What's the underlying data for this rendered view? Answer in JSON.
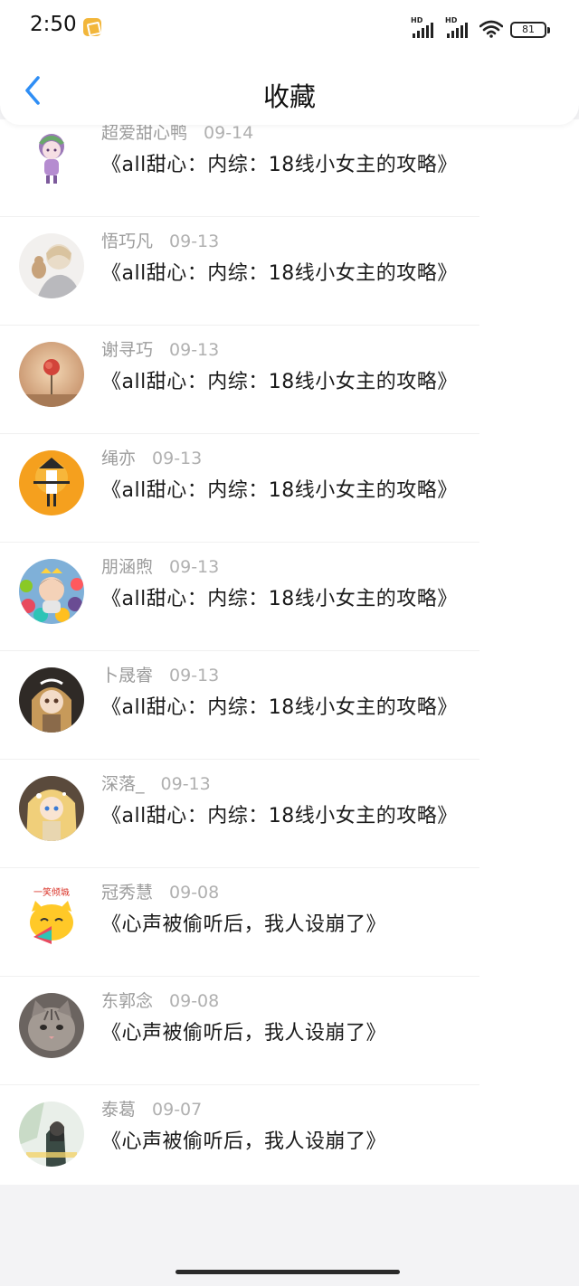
{
  "status_bar": {
    "time": "2:50",
    "hd1": "HD",
    "hd2": "HD",
    "battery": "81"
  },
  "header": {
    "title": "收藏"
  },
  "icons": {
    "back": "chevron-left-icon",
    "wifi": "wifi-icon",
    "battery": "battery-icon",
    "notification": "notification-icon"
  },
  "colors": {
    "accent": "#2f8ef5",
    "meta_text": "#9c9c9c",
    "title_text": "#1a1a1a"
  },
  "favorites": [
    {
      "user": "超爱甜心鸭",
      "date": "09-14",
      "title": "《all甜心：内综：18线小女主的攻略》"
    },
    {
      "user": "悟巧凡",
      "date": "09-13",
      "title": "《all甜心：内综：18线小女主的攻略》"
    },
    {
      "user": "谢寻巧",
      "date": "09-13",
      "title": "《all甜心：内综：18线小女主的攻略》"
    },
    {
      "user": "绳亦",
      "date": "09-13",
      "title": "《all甜心：内综：18线小女主的攻略》"
    },
    {
      "user": "朋涵煦",
      "date": "09-13",
      "title": "《all甜心：内综：18线小女主的攻略》"
    },
    {
      "user": "卜晟睿",
      "date": "09-13",
      "title": "《all甜心：内综：18线小女主的攻略》"
    },
    {
      "user": "深落_",
      "date": "09-13",
      "title": "《all甜心：内综：18线小女主的攻略》"
    },
    {
      "user": "冠秀慧",
      "date": "09-08",
      "title": "《心声被偷听后，我人设崩了》",
      "avatar_text": "一笑倾城"
    },
    {
      "user": "东郭念",
      "date": "09-08",
      "title": "《心声被偷听后，我人设崩了》"
    },
    {
      "user": "泰葛",
      "date": "09-07",
      "title": "《心声被偷听后，我人设崩了》"
    }
  ]
}
